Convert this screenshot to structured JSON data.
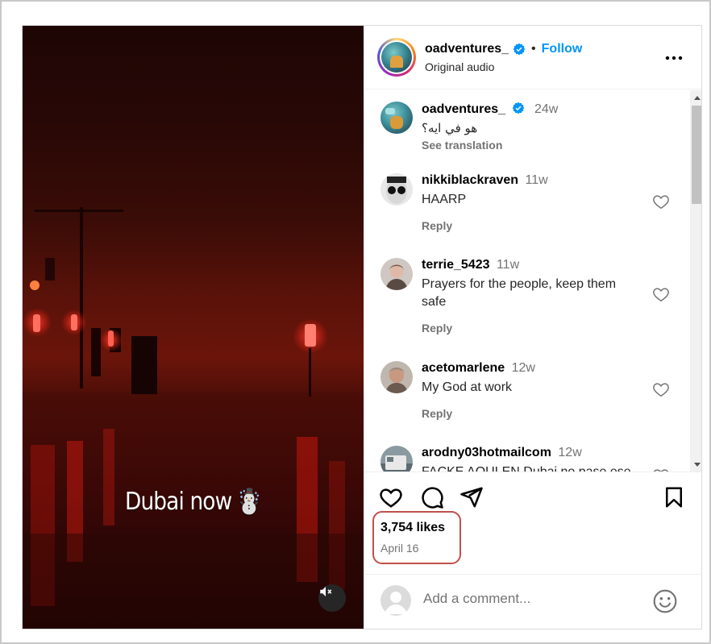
{
  "media": {
    "overlay_text": "Dubai now",
    "overlay_emoji": "☃️",
    "mute_icon": "speaker-muted-icon"
  },
  "header": {
    "username": "oadventures_",
    "separator": "•",
    "follow_label": "Follow",
    "audio_label": "Original audio"
  },
  "comments": [
    {
      "user": "oadventures_",
      "verified": true,
      "time": "24w",
      "text": "هو في ايه؟",
      "sub": "See translation"
    },
    {
      "user": "nikkiblackraven",
      "time": "11w",
      "text": "HAARP",
      "sub": "Reply"
    },
    {
      "user": "terrie_5423",
      "time": "11w",
      "text": "Prayers for the people, keep them safe",
      "sub": "Reply"
    },
    {
      "user": "acetomarlene",
      "time": "12w",
      "text": "My God at work",
      "sub": "Reply"
    },
    {
      "user": "arodny03hotmailcom",
      "time": "12w",
      "text": "FACKE AQULEN Dubai no pase ese",
      "sub": ""
    }
  ],
  "post": {
    "likes": "3,754 likes",
    "date": "April 16"
  },
  "composer": {
    "placeholder": "Add a comment..."
  },
  "colors": {
    "accent": "#0095f6",
    "highlight_box": "#c0504d"
  }
}
